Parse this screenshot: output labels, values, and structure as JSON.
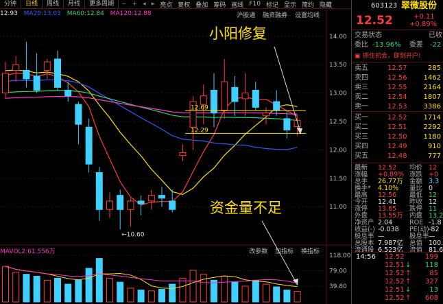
{
  "toolbar": {
    "tabs": [
      "分钟",
      "日线",
      "周线",
      "月线",
      "更多周期"
    ],
    "active_tab": "日线",
    "tools": [
      "亮点",
      "复权",
      "叠加",
      "筹码",
      "画线",
      "F10",
      "标记",
      "显示",
      "简约",
      "隐藏"
    ],
    "sub_tools": [
      "沪股通",
      "融资融券",
      "设置均线"
    ]
  },
  "ma": [
    {
      "label": "12.93",
      "color": "#e6e6e6"
    },
    {
      "label": "MA20:13.03",
      "color": "#2b5cff"
    },
    {
      "label": "MA60:12.84",
      "color": "#2fd66b"
    },
    {
      "label": "MA120:12.88",
      "color": "#ff33cc"
    }
  ],
  "annotations": {
    "top": "小阳修复",
    "bottom": "资金量不足",
    "low_label": "←10.60",
    "level_high": "12.69",
    "level_low": "12.29"
  },
  "y_axis": [
    "14.00",
    "13.50",
    "13.00",
    "12.50",
    "12.00",
    "11.50",
    "11.00"
  ],
  "volume": {
    "header": "MAVOL2:61.556万",
    "tools": [
      "改参数",
      "加指标",
      "换指标"
    ],
    "axis": [
      "118.00",
      "79.00",
      "39.80"
    ]
  },
  "chart_data": {
    "type": "candlestick",
    "ylim": [
      10.35,
      14.3
    ],
    "candles": [
      {
        "o": 13.0,
        "h": 13.55,
        "l": 12.9,
        "c": 13.35
      },
      {
        "o": 13.4,
        "h": 13.65,
        "l": 13.2,
        "c": 13.5
      },
      {
        "o": 13.4,
        "h": 13.9,
        "l": 13.1,
        "c": 13.25
      },
      {
        "o": 13.3,
        "h": 13.7,
        "l": 13.0,
        "c": 13.05
      },
      {
        "o": 13.4,
        "h": 13.6,
        "l": 13.25,
        "c": 13.55
      },
      {
        "o": 13.6,
        "h": 13.75,
        "l": 13.05,
        "c": 13.1
      },
      {
        "o": 13.05,
        "h": 13.2,
        "l": 12.85,
        "c": 12.95
      },
      {
        "o": 12.8,
        "h": 12.85,
        "l": 12.1,
        "c": 12.45
      },
      {
        "o": 12.4,
        "h": 12.55,
        "l": 11.6,
        "c": 11.75
      },
      {
        "o": 11.6,
        "h": 11.7,
        "l": 10.75,
        "c": 10.95
      },
      {
        "o": 10.95,
        "h": 11.25,
        "l": 10.8,
        "c": 11.1
      },
      {
        "o": 11.2,
        "h": 11.3,
        "l": 10.6,
        "c": 10.95
      },
      {
        "o": 10.95,
        "h": 11.15,
        "l": 10.65,
        "c": 11.1
      },
      {
        "o": 11.1,
        "h": 11.2,
        "l": 10.85,
        "c": 11.05
      },
      {
        "o": 11.1,
        "h": 11.3,
        "l": 10.95,
        "c": 11.2
      },
      {
        "o": 11.2,
        "h": 11.35,
        "l": 11.0,
        "c": 11.15
      },
      {
        "o": 11.1,
        "h": 11.3,
        "l": 10.9,
        "c": 10.95
      },
      {
        "o": 11.9,
        "h": 12.1,
        "l": 11.8,
        "c": 11.95
      },
      {
        "o": 12.4,
        "h": 12.95,
        "l": 12.0,
        "c": 12.85
      },
      {
        "o": 12.8,
        "h": 13.15,
        "l": 12.45,
        "c": 12.95
      },
      {
        "o": 13.05,
        "h": 13.35,
        "l": 12.4,
        "c": 12.65
      },
      {
        "o": 12.7,
        "h": 13.6,
        "l": 12.55,
        "c": 13.2
      },
      {
        "o": 13.1,
        "h": 13.3,
        "l": 12.6,
        "c": 12.85
      },
      {
        "o": 12.9,
        "h": 13.35,
        "l": 12.6,
        "c": 13.0
      },
      {
        "o": 13.05,
        "h": 13.2,
        "l": 12.7,
        "c": 12.75
      },
      {
        "o": 12.6,
        "h": 12.75,
        "l": 12.45,
        "c": 12.65
      },
      {
        "o": 12.85,
        "h": 13.05,
        "l": 12.6,
        "c": 12.7
      },
      {
        "o": 12.55,
        "h": 12.7,
        "l": 12.2,
        "c": 12.35
      },
      {
        "o": 12.41,
        "h": 12.6,
        "l": 12.25,
        "c": 12.52
      }
    ],
    "volume": [
      90,
      75,
      70,
      65,
      55,
      60,
      45,
      55,
      85,
      110,
      60,
      50,
      35,
      30,
      28,
      32,
      45,
      60,
      80,
      70,
      55,
      65,
      50,
      40,
      55,
      45,
      38,
      30,
      26.77
    ]
  },
  "quote": {
    "code": "603123",
    "name": "翠微股份",
    "price": "12.52",
    "change": "+0.11",
    "pct": "+0.89%",
    "status_label": "交易状态",
    "status_value": "已收",
    "weibi_label": "委比",
    "weibi": "-13.96%",
    "weicha_label": "委差",
    "weicha": "-22",
    "banner": "抓住机会，即刻开户!",
    "asks": [
      {
        "label": "卖五",
        "price": "12.57",
        "vol": "285"
      },
      {
        "label": "卖四",
        "price": "12.56",
        "vol": "1462"
      },
      {
        "label": "卖三",
        "price": "12.55",
        "vol": "2164"
      },
      {
        "label": "卖二",
        "price": "12.54",
        "vol": "1807"
      },
      {
        "label": "卖一",
        "price": "12.53",
        "vol": "3386"
      }
    ],
    "bids": [
      {
        "label": "买一",
        "price": "12.52",
        "vol": "1714"
      },
      {
        "label": "买二",
        "price": "12.51",
        "vol": "2292"
      },
      {
        "label": "买三",
        "price": "12.50",
        "vol": "1180"
      },
      {
        "label": "买四",
        "price": "12.49",
        "vol": "910"
      },
      {
        "label": "买五",
        "price": "12.48",
        "vol": "777"
      }
    ],
    "stats": [
      {
        "l1": "最新",
        "v1": "12.52",
        "c1": "red",
        "l2": "均价",
        "v2": "12",
        "c2": "red"
      },
      {
        "l1": "涨幅",
        "v1": "+0.89%",
        "c1": "red",
        "l2": "涨跌",
        "v2": "+0",
        "c2": "red"
      },
      {
        "l1": "总手",
        "v1": "26.77万",
        "c1": "yellow",
        "l2": "金额",
        "v2": "3.3",
        "c2": "cyan"
      },
      {
        "l1": "换手*",
        "v1": "4.10%",
        "c1": "yellow",
        "l2": "量比",
        "v2": "0",
        "c2": "white"
      },
      {
        "l1": "最高",
        "v1": "12.56",
        "c1": "red",
        "l2": "最低",
        "v2": "12",
        "c2": "green"
      },
      {
        "l1": "今开",
        "v1": "12.41",
        "c1": "white",
        "l2": "昨收",
        "v2": "12",
        "c2": "white"
      },
      {
        "l1": "涨停",
        "v1": "13.65",
        "c1": "red",
        "l2": "跌停",
        "v2": "11",
        "c2": "green"
      },
      {
        "l1": "外盘",
        "v1": "13.55万",
        "c1": "red",
        "l2": "内盘",
        "v2": "13.2",
        "c2": "green"
      },
      {
        "l1": "净资产",
        "v1": "2.04",
        "c1": "white",
        "l2": "ROE",
        "v2": "-1.8",
        "c2": "white"
      },
      {
        "l1": "收益(-)",
        "v1": "-0.038",
        "c1": "white",
        "l2": "PE(动)",
        "v2": "-82",
        "c2": "white"
      },
      {
        "l1": "股息率",
        "v1": "—",
        "c1": "white",
        "l2": "股息率",
        "v2": "—",
        "c2": "white"
      },
      {
        "l1": "总股本",
        "v1": "7.987亿",
        "c1": "white",
        "l2": "总值",
        "v2": "100.0",
        "c2": "white"
      },
      {
        "l1": "流通股",
        "v1": "6.523亿",
        "c1": "white",
        "l2": "流值",
        "v2": "81.6",
        "c2": "white"
      }
    ],
    "ticks": [
      {
        "time": "14:56",
        "price": "12.52",
        "vol": "199",
        "arrow": ""
      },
      {
        "time": "",
        "price": "12.51",
        "vol": "118",
        "arrow": "↓"
      },
      {
        "time": "",
        "price": "12.52",
        "vol": "85",
        "arrow": "↑"
      },
      {
        "time": "",
        "price": "12.52",
        "vol": "327",
        "arrow": "↑"
      },
      {
        "time": "",
        "price": "12.51",
        "vol": "13",
        "arrow": "↓"
      },
      {
        "time": "",
        "price": "12.52",
        "vol": "608",
        "arrow": "↑"
      }
    ]
  }
}
